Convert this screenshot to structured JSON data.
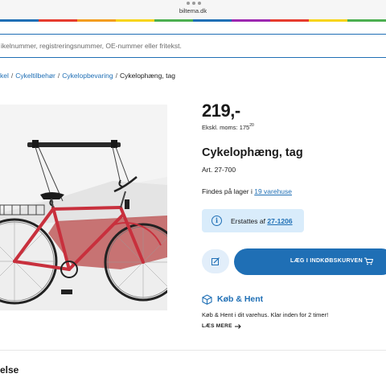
{
  "browser": {
    "url": "biltema.dk",
    "strip_colors": [
      "#1f6fb5",
      "#e63b2e",
      "#f39c1f",
      "#f7d417",
      "#4caf50",
      "#1f6fb5",
      "#9c27b0",
      "#e63b2e",
      "#f7d417",
      "#4caf50"
    ]
  },
  "search": {
    "placeholder": "ikelnummer, registreringsnummer, OE-nummer eller fritekst."
  },
  "breadcrumb": {
    "items": [
      "kel",
      "Cykeltilbehør",
      "Cykelopbevaring"
    ],
    "current": "Cykelophæng, tag",
    "separator": "/"
  },
  "product": {
    "price": "219,-",
    "ex_vat_label": "Ekskl. moms:",
    "ex_vat_value": "175",
    "ex_vat_cents": "20",
    "title": "Cykelophæng, tag",
    "article_no": "Art. 27-700",
    "stock_text": "Findes på lager i",
    "stock_link": "19 varehuse",
    "replaced_label": "Erstattes af",
    "replaced_link": "27-1206",
    "cart_button": "LÆG I INDKØBSKURVEN"
  },
  "click_collect": {
    "title": "Køb & Hent",
    "text": "Køb & Hent i dit varehus. Klar inden for 2 timer!",
    "more": "LÆS MERE"
  },
  "section": {
    "title": "else"
  },
  "colors": {
    "accent": "#1f6fb5",
    "info_bg": "#d9ecfb",
    "bike_frame": "#c8303d"
  },
  "icons": [
    "info-icon",
    "edit-icon",
    "cart-icon",
    "box-icon",
    "arrow-right-icon"
  ]
}
